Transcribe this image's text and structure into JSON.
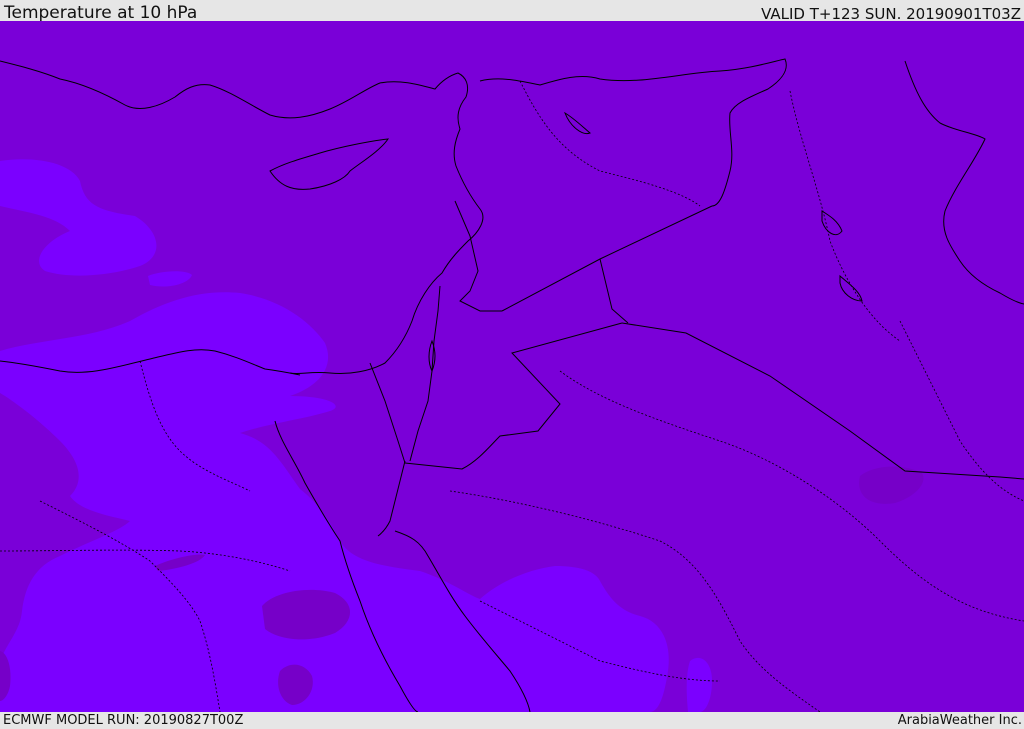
{
  "header": {
    "title": "Temperature at 10 hPa",
    "valid_time": "VALID T+123 SUN. 20190901T03Z"
  },
  "footer": {
    "model_run": "ECMWF MODEL RUN: 20190827T00Z",
    "credit": "ArabiaWeather Inc."
  },
  "map": {
    "region": "Eastern Mediterranean / Middle East",
    "colors": {
      "field_dominant": "#7a00d8",
      "field_cooler": "#7b00ff",
      "field_warmer": "#7600c8",
      "boundary_line": "#000000"
    }
  }
}
